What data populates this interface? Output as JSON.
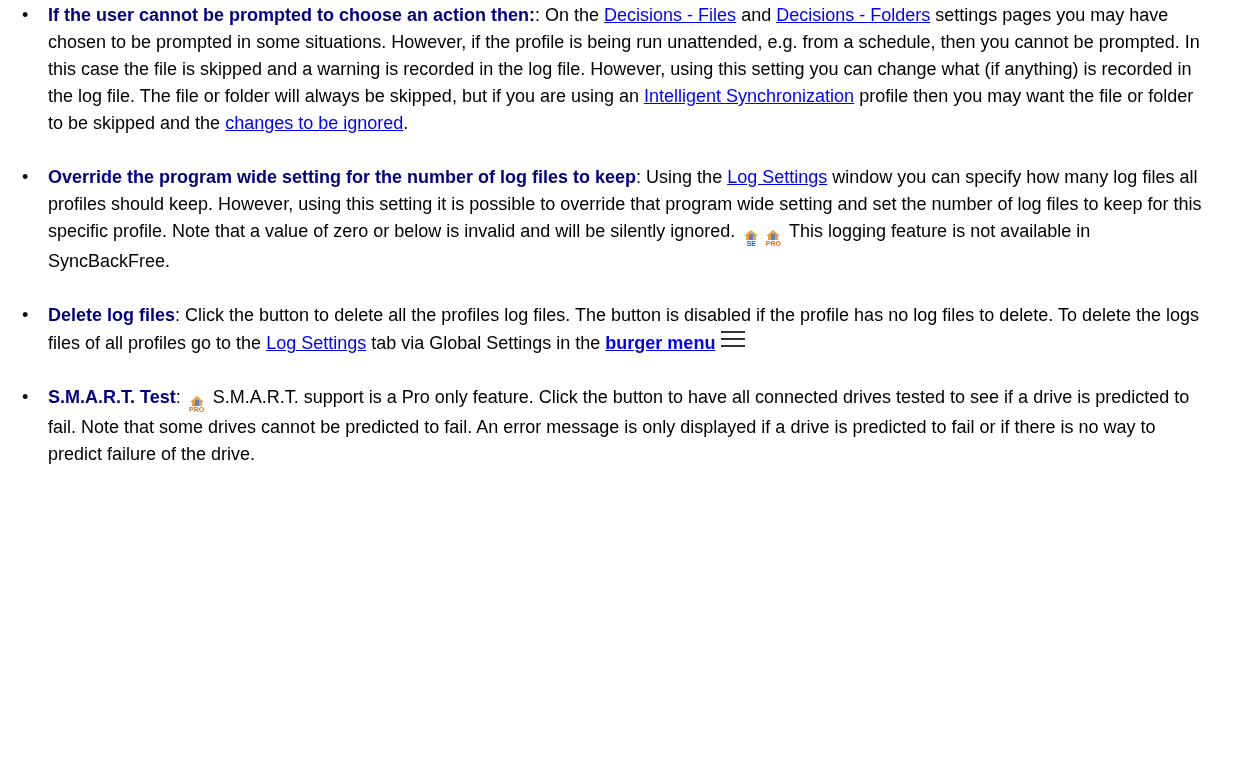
{
  "bullet": "•",
  "items": [
    {
      "title": "If the user cannot be prompted to choose an action then:",
      "body": [
        {
          "kind": "text",
          "text": ": On the "
        },
        {
          "kind": "link",
          "text": "Decisions - Files"
        },
        {
          "kind": "text",
          "text": " and "
        },
        {
          "kind": "link",
          "text": "Decisions - Folders"
        },
        {
          "kind": "text",
          "text": " settings pages you may have chosen to be prompted in some situations. However, if the profile is being run unattended, e.g. from a schedule, then you cannot be prompted. In this case the file is skipped and a warning is recorded in the log file. However, using this setting you can change what (if anything) is recorded in the log file. The file or folder will always be skipped, but if you are using an "
        },
        {
          "kind": "link",
          "text": "Intelligent Synchronization"
        },
        {
          "kind": "text",
          "text": " profile then you may want the file or folder to be skipped and the "
        },
        {
          "kind": "link",
          "text": "changes to be ignored"
        },
        {
          "kind": "text",
          "text": "."
        }
      ]
    },
    {
      "title": "Override the program wide setting for the number of log files to keep",
      "body": [
        {
          "kind": "text",
          "text": ": Using the "
        },
        {
          "kind": "link",
          "text": "Log Settings"
        },
        {
          "kind": "text",
          "text": " window you can specify how many log files all profiles should keep. However, using this setting it is possible to override that program wide setting and set the number of log files to keep for this specific profile. Note that a value of zero or below is invalid and will be silently ignored. "
        },
        {
          "kind": "badge",
          "text": "SE"
        },
        {
          "kind": "badge",
          "text": "PRO"
        },
        {
          "kind": "text",
          "text": " This logging feature is not available in SyncBackFree."
        }
      ]
    },
    {
      "title": "Delete log files",
      "body": [
        {
          "kind": "text",
          "text": ": Click the button to delete all the profiles log files. The button is disabled if the profile has no log files to delete. To delete the logs files of all profiles go to the "
        },
        {
          "kind": "link",
          "text": "Log Settings"
        },
        {
          "kind": "text",
          "text": " tab via Global Settings in the "
        },
        {
          "kind": "strong_link",
          "text": "burger menu"
        },
        {
          "kind": "menu_icon"
        }
      ]
    },
    {
      "title": "S.M.A.R.T. Test",
      "body": [
        {
          "kind": "text",
          "text": ": "
        },
        {
          "kind": "badge",
          "text": "PRO"
        },
        {
          "kind": "text",
          "text": " S.M.A.R.T. support is a Pro only feature. Click the button to have all connected drives tested to see if a drive is predicted to fail. Note that some drives cannot be predicted to fail. An error message is only displayed if a drive is predicted to fail or if there is no way to predict failure of the drive."
        }
      ]
    }
  ]
}
